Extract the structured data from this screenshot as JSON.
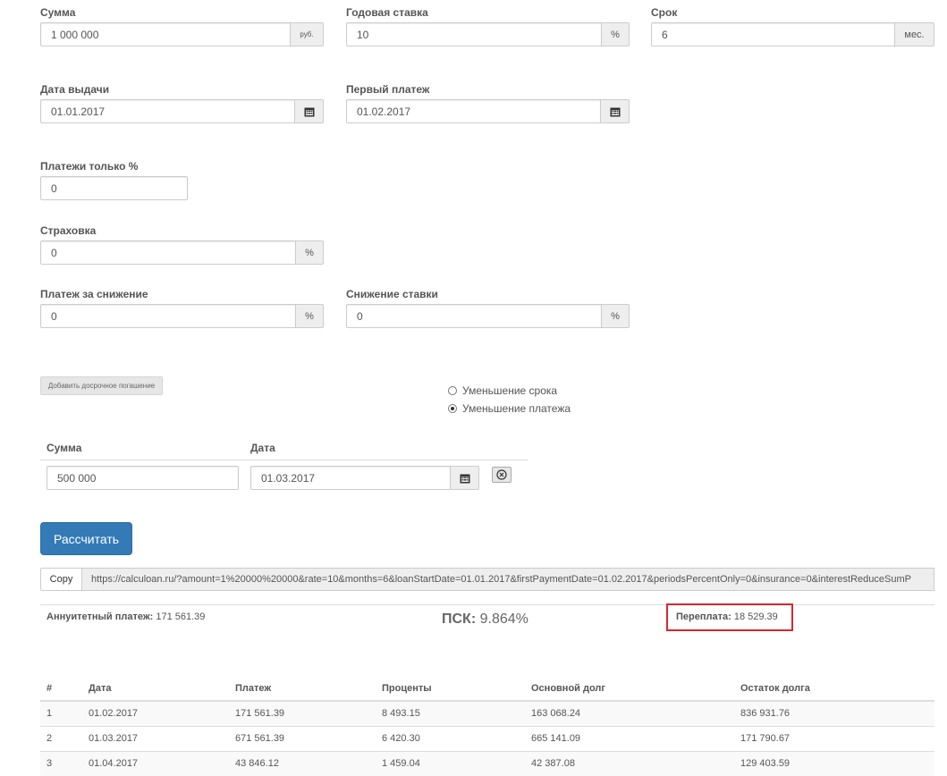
{
  "form": {
    "amount": {
      "label": "Сумма",
      "value": "1 000 000",
      "unit": "руб."
    },
    "rate": {
      "label": "Годовая ставка",
      "value": "10",
      "unit": "%"
    },
    "term": {
      "label": "Срок",
      "value": "6",
      "unit": "мес."
    },
    "issue_date": {
      "label": "Дата выдачи",
      "value": "01.01.2017"
    },
    "first_payment": {
      "label": "Первый платеж",
      "value": "01.02.2017"
    },
    "percent_only": {
      "label": "Платежи только %",
      "value": "0"
    },
    "insurance": {
      "label": "Страховка",
      "value": "0",
      "unit": "%"
    },
    "reduce_payment": {
      "label": "Платеж за снижение",
      "value": "0",
      "unit": "%"
    },
    "rate_reduction": {
      "label": "Снижение ставки",
      "value": "0",
      "unit": "%"
    }
  },
  "early": {
    "add_label": "Добавить досрочное погашение",
    "options": [
      {
        "label": "Уменьшение срока",
        "selected": false
      },
      {
        "label": "Уменьшение платежа",
        "selected": true
      }
    ],
    "col_amount": "Сумма",
    "col_date": "Дата",
    "row": {
      "amount": "500 000",
      "date": "01.03.2017"
    }
  },
  "calc_button": "Рассчитать",
  "link": {
    "copy_label": "Copy",
    "url": "https://calculoan.ru/?amount=1%20000%20000&rate=10&months=6&loanStartDate=01.01.2017&firstPaymentDate=01.02.2017&periodsPercentOnly=0&insurance=0&interestReduceSumP"
  },
  "results": {
    "annuity_label": "Аннуитетный платеж:",
    "annuity_value": "171 561.39",
    "psk_label": "ПСК:",
    "psk_value": "9.864%",
    "overpay_label": "Переплата:",
    "overpay_value": "18 529.39"
  },
  "schedule": {
    "headers": [
      "#",
      "Дата",
      "Платеж",
      "Проценты",
      "Основной долг",
      "Остаток долга"
    ],
    "rows": [
      [
        "1",
        "01.02.2017",
        "171 561.39",
        "8 493.15",
        "163 068.24",
        "836 931.76"
      ],
      [
        "2",
        "01.03.2017",
        "671 561.39",
        "6 420.30",
        "665 141.09",
        "171 790.67"
      ],
      [
        "3",
        "01.04.2017",
        "43 846.12",
        "1 459.04",
        "42 387.08",
        "129 403.59"
      ]
    ]
  },
  "colors": {
    "primary": "#337ab7",
    "highlight": "#d9262e"
  }
}
